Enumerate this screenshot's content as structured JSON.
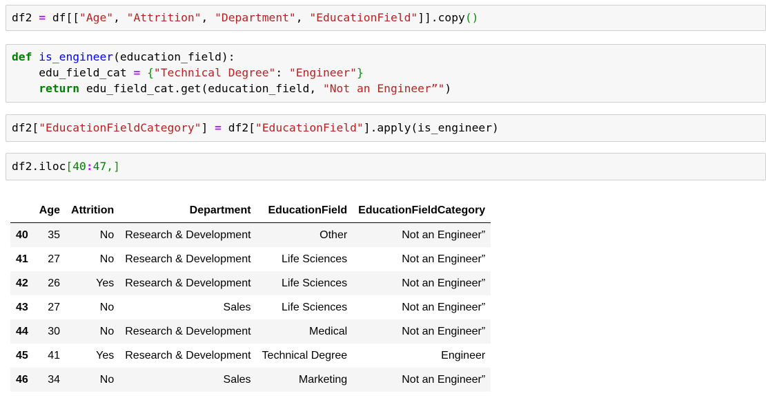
{
  "cells": [
    {
      "lines": [
        [
          {
            "t": "df2 ",
            "c": "plain"
          },
          {
            "t": "=",
            "c": "op"
          },
          {
            "t": " df[[",
            "c": "plain"
          },
          {
            "t": "\"Age\"",
            "c": "str"
          },
          {
            "t": ", ",
            "c": "plain"
          },
          {
            "t": "\"Attrition\"",
            "c": "str"
          },
          {
            "t": ", ",
            "c": "plain"
          },
          {
            "t": "\"Department\"",
            "c": "str"
          },
          {
            "t": ", ",
            "c": "plain"
          },
          {
            "t": "\"EducationField\"",
            "c": "str"
          },
          {
            "t": "]].copy",
            "c": "plain"
          },
          {
            "t": "()",
            "c": "br"
          }
        ]
      ]
    },
    {
      "lines": [
        [
          {
            "t": "def",
            "c": "kw"
          },
          {
            "t": " ",
            "c": "plain"
          },
          {
            "t": "is_engineer",
            "c": "fn"
          },
          {
            "t": "(education_field):",
            "c": "plain"
          }
        ],
        [
          {
            "t": "    edu_field_cat ",
            "c": "plain"
          },
          {
            "t": "=",
            "c": "op"
          },
          {
            "t": " ",
            "c": "plain"
          },
          {
            "t": "{",
            "c": "br"
          },
          {
            "t": "\"Technical Degree\"",
            "c": "str"
          },
          {
            "t": ": ",
            "c": "plain"
          },
          {
            "t": "\"Engineer\"",
            "c": "str"
          },
          {
            "t": "}",
            "c": "br"
          }
        ],
        [
          {
            "t": "    ",
            "c": "plain"
          },
          {
            "t": "return",
            "c": "kw"
          },
          {
            "t": " edu_field_cat.get(education_field, ",
            "c": "plain"
          },
          {
            "t": "\"Not an Engineer”\"",
            "c": "str"
          },
          {
            "t": ")",
            "c": "plain"
          }
        ]
      ]
    },
    {
      "lines": [
        [
          {
            "t": "df2[",
            "c": "plain"
          },
          {
            "t": "\"EducationFieldCategory\"",
            "c": "str"
          },
          {
            "t": "] ",
            "c": "plain"
          },
          {
            "t": "=",
            "c": "op"
          },
          {
            "t": " df2[",
            "c": "plain"
          },
          {
            "t": "\"EducationField\"",
            "c": "str"
          },
          {
            "t": "].apply(is_engineer)",
            "c": "plain"
          }
        ]
      ]
    },
    {
      "lines": [
        [
          {
            "t": "df2.iloc",
            "c": "plain"
          },
          {
            "t": "[",
            "c": "br"
          },
          {
            "t": "40",
            "c": "num"
          },
          {
            "t": ":",
            "c": "op"
          },
          {
            "t": "47",
            "c": "num"
          },
          {
            "t": ",]",
            "c": "br"
          }
        ]
      ]
    }
  ],
  "table": {
    "columns": [
      "",
      "Age",
      "Attrition",
      "Department",
      "EducationField",
      "EducationFieldCategory"
    ],
    "rows": [
      {
        "index": "40",
        "cells": [
          "35",
          "No",
          "Research & Development",
          "Other",
          "Not an Engineer”"
        ]
      },
      {
        "index": "41",
        "cells": [
          "27",
          "No",
          "Research & Development",
          "Life Sciences",
          "Not an Engineer”"
        ]
      },
      {
        "index": "42",
        "cells": [
          "26",
          "Yes",
          "Research & Development",
          "Life Sciences",
          "Not an Engineer”"
        ]
      },
      {
        "index": "43",
        "cells": [
          "27",
          "No",
          "Sales",
          "Life Sciences",
          "Not an Engineer”"
        ]
      },
      {
        "index": "44",
        "cells": [
          "30",
          "No",
          "Research & Development",
          "Medical",
          "Not an Engineer”"
        ]
      },
      {
        "index": "45",
        "cells": [
          "41",
          "Yes",
          "Research & Development",
          "Technical Degree",
          "Engineer"
        ]
      },
      {
        "index": "46",
        "cells": [
          "34",
          "No",
          "Sales",
          "Marketing",
          "Not an Engineer”"
        ]
      }
    ]
  },
  "colors": {
    "cell_bg": "#f7f7f7",
    "cell_border": "#cfcfcf",
    "string": "#ba2121",
    "keyword": "#008000",
    "operator": "#aa22ff",
    "function_name": "#0000ff",
    "row_stripe": "#f5f5f5"
  }
}
